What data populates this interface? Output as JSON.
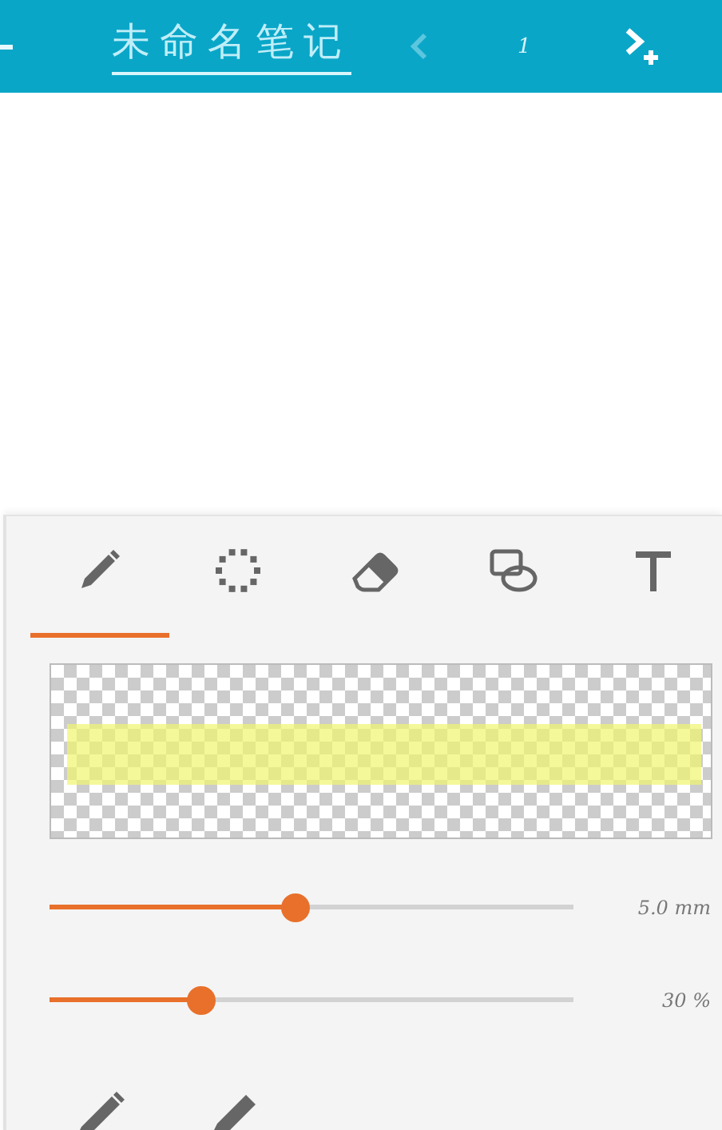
{
  "top_bar": {
    "note_title": "未命名笔记",
    "page_number": "1"
  },
  "tool_tabs": [
    {
      "kind": "pen",
      "selected": true
    },
    {
      "kind": "lasso",
      "selected": false
    },
    {
      "kind": "eraser",
      "selected": false
    },
    {
      "kind": "shapes",
      "selected": false
    },
    {
      "kind": "text",
      "selected": false
    }
  ],
  "sliders": [
    {
      "level": 0.47,
      "reading": "5.0 mm"
    },
    {
      "level": 0.29,
      "reading": "30 %"
    }
  ],
  "pen_styles": [
    {
      "kind": "pencil"
    },
    {
      "kind": "marker"
    }
  ]
}
